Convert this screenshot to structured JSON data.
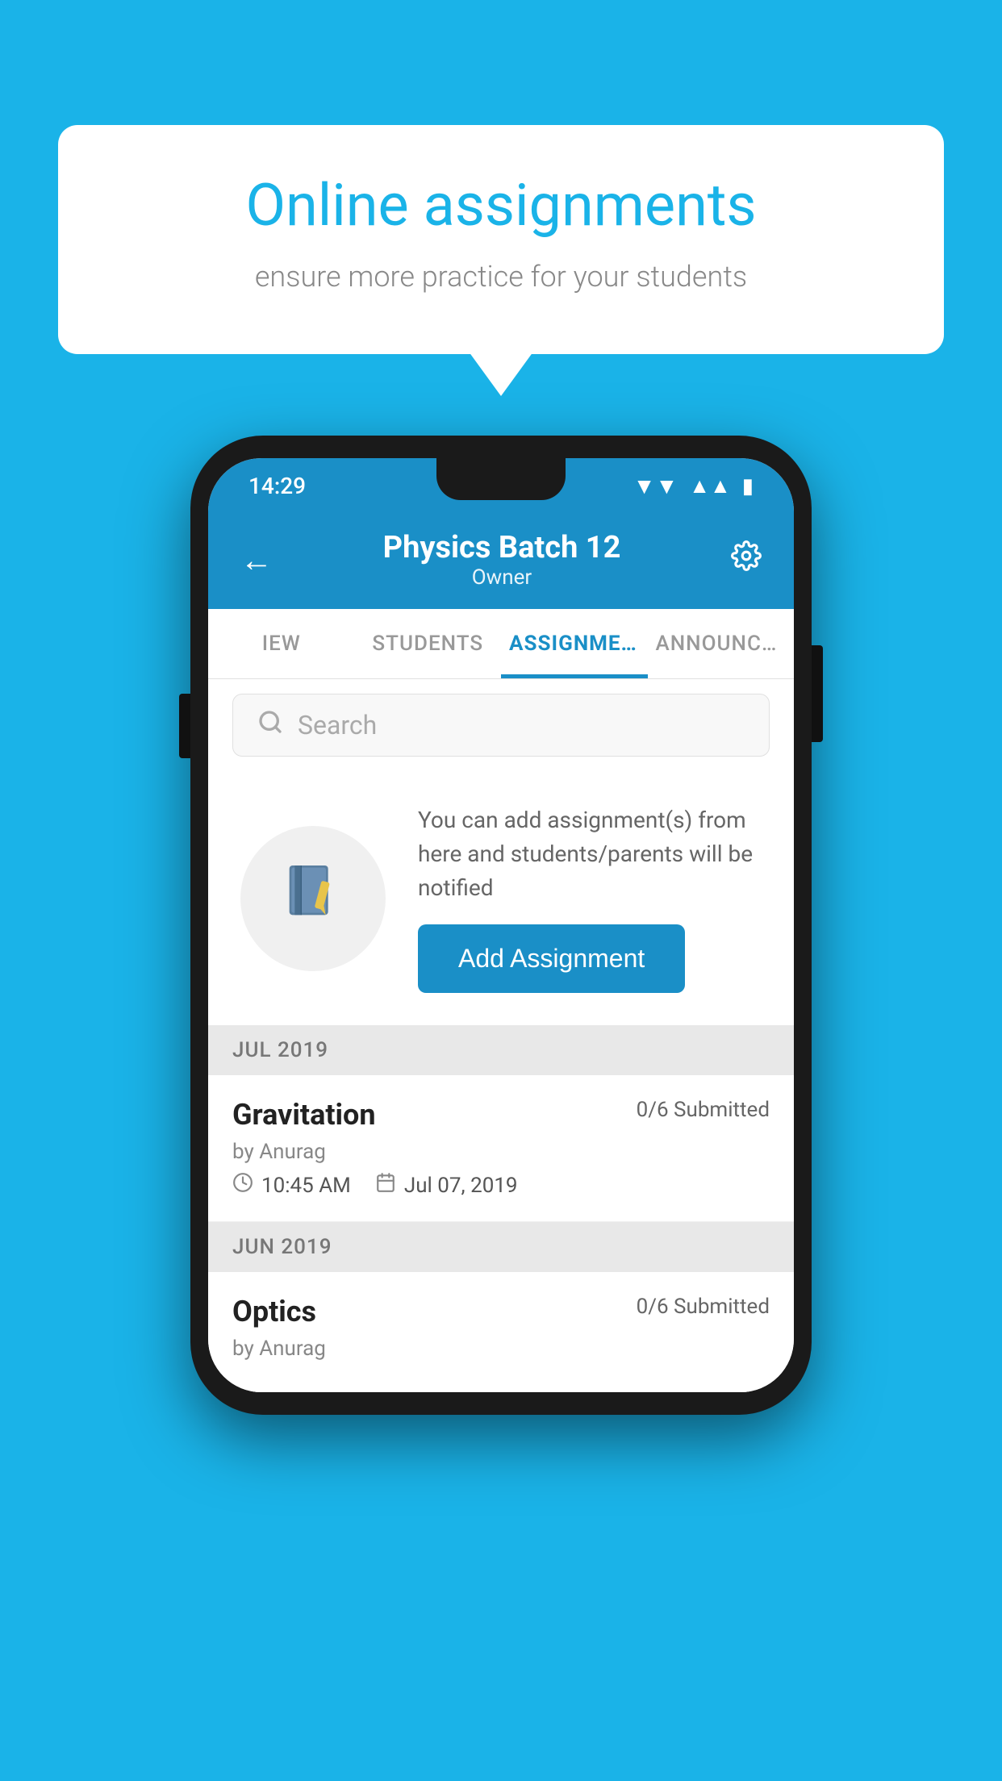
{
  "background": {
    "color": "#1ab3e8"
  },
  "speech_bubble": {
    "title": "Online assignments",
    "subtitle": "ensure more practice for your students"
  },
  "status_bar": {
    "time": "14:29",
    "wifi": "▼",
    "signal": "▲",
    "battery": "▮"
  },
  "app_bar": {
    "back_label": "←",
    "title": "Physics Batch 12",
    "subtitle": "Owner",
    "settings_label": "⚙"
  },
  "tabs": [
    {
      "id": "iew",
      "label": "IEW",
      "active": false
    },
    {
      "id": "students",
      "label": "STUDENTS",
      "active": false
    },
    {
      "id": "assignments",
      "label": "ASSIGNMENTS",
      "active": true
    },
    {
      "id": "announcements",
      "label": "ANNOUNCEMENTS",
      "active": false
    }
  ],
  "search": {
    "placeholder": "Search"
  },
  "add_prompt": {
    "text": "You can add assignment(s) from here and students/parents will be notified",
    "button_label": "Add Assignment"
  },
  "sections": [
    {
      "header": "JUL 2019",
      "items": [
        {
          "name": "Gravitation",
          "submitted": "0/6 Submitted",
          "by": "by Anurag",
          "time": "10:45 AM",
          "date": "Jul 07, 2019"
        }
      ]
    },
    {
      "header": "JUN 2019",
      "items": [
        {
          "name": "Optics",
          "submitted": "0/6 Submitted",
          "by": "by Anurag",
          "time": "",
          "date": ""
        }
      ]
    }
  ]
}
